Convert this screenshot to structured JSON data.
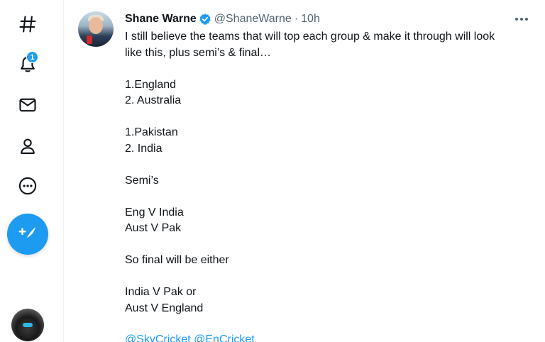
{
  "sidebar": {
    "notification_count": "1",
    "icons": [
      "hashtag-icon",
      "bell-icon",
      "mail-icon",
      "person-icon",
      "more-circle-icon",
      "compose-icon"
    ]
  },
  "tweet": {
    "author_name": "Shane Warne",
    "handle": "@ShaneWarne",
    "separator": "·",
    "time": "10h",
    "text": {
      "line1": "I still believe the teams that will top each group & make it through will look",
      "line2": "like this, plus semi’s & final…",
      "line3": "1.England",
      "line4": "2. Australia",
      "line5": "1.Pakistan",
      "line6": "2. India",
      "line7": "Semi’s",
      "line8": "Eng V India",
      "line9": "Aust V Pak",
      "line10": "So final will be either",
      "line11": "India V Pak or",
      "line12": "Aust V England"
    },
    "mentions_partial": "@SkyCricket @EnCricket"
  },
  "colors": {
    "accent": "#1d9bf0",
    "text": "#0f1419",
    "muted": "#536471"
  }
}
